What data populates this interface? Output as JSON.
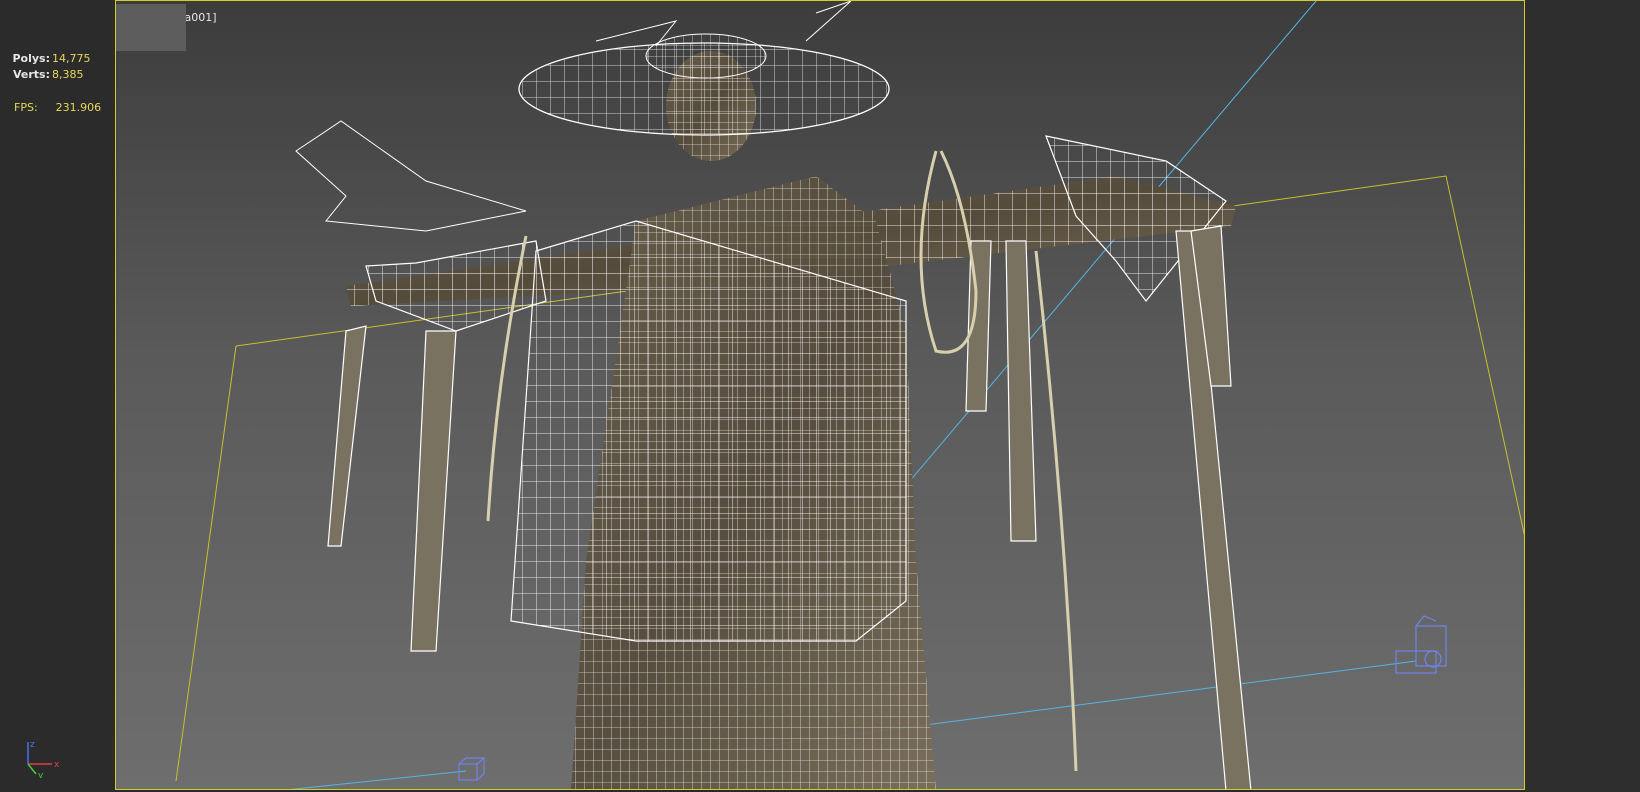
{
  "viewport": {
    "menu_label": "[+]",
    "camera_label": "[Camera001]"
  },
  "stats": {
    "polys_label": "Polys:",
    "polys_value": "14,775",
    "verts_label": "Verts:",
    "verts_value": "8,385",
    "fps_label": "FPS:",
    "fps_value": "231.906"
  },
  "gizmo": {
    "x_label": "x",
    "y_label": "y",
    "z_label": "z"
  },
  "colors": {
    "viewport_border": "#d4cc2a",
    "wireframe": "#ffffff",
    "camera_line": "#55b4e6",
    "gizmo_box": "#6f84e8",
    "stat_value": "#e6d85a"
  },
  "icons": [
    "axis-gizmo-icon",
    "camera-gizmo-icon"
  ]
}
